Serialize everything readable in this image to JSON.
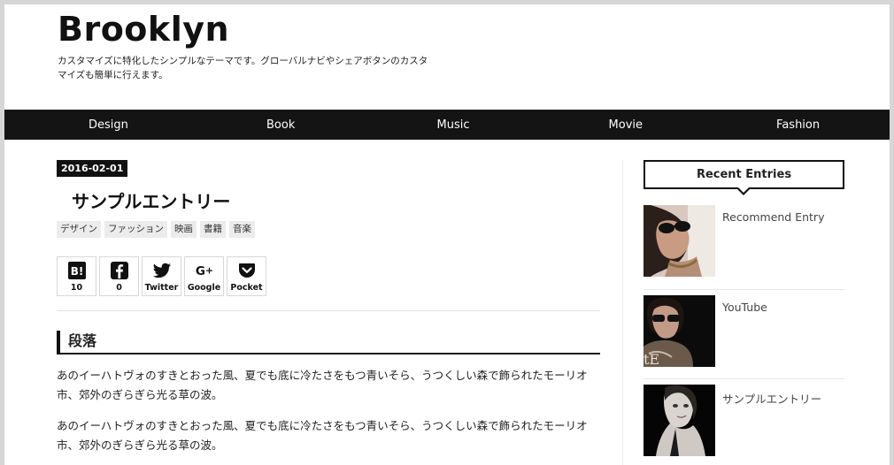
{
  "site": {
    "title": "Brooklyn",
    "description": "カスタマイズに特化したシンプルなテーマです。グローバルナビやシェアボタンのカスタマイズも簡単に行えます。"
  },
  "nav": {
    "items": [
      "Design",
      "Book",
      "Music",
      "Movie",
      "Fashion"
    ]
  },
  "entry": {
    "date": "2016-02-01",
    "title": "サンプルエントリー",
    "tags": [
      "デザイン",
      "ファッション",
      "映画",
      "書籍",
      "音楽"
    ],
    "share": [
      {
        "icon": "hatena-bookmark-icon",
        "label": "10"
      },
      {
        "icon": "facebook-icon",
        "label": "0"
      },
      {
        "icon": "twitter-icon",
        "label": "Twitter"
      },
      {
        "icon": "google-plus-icon",
        "label": "Google"
      },
      {
        "icon": "pocket-icon",
        "label": "Pocket"
      }
    ],
    "heading": "段落",
    "paragraphs": [
      "あのイーハトヴォのすきとおった風、夏でも底に冷たさをもつ青いそら、うつくしい森で飾られたモーリオ市、郊外のぎらぎら光る草の波。",
      "あのイーハトヴォのすきとおった風、夏でも底に冷たさをもつ青いそら、うつくしい森で飾られたモーリオ市、郊外のぎらぎら光る草の波。"
    ]
  },
  "sidebar": {
    "widget_title": "Recent Entries",
    "entries": [
      {
        "title": "Recommend Entry"
      },
      {
        "title": "YouTube"
      },
      {
        "title": "サンプルエントリー"
      }
    ]
  },
  "colors": {
    "nav_background": "#141414",
    "text": "#222222",
    "tag_background": "#ececec"
  }
}
